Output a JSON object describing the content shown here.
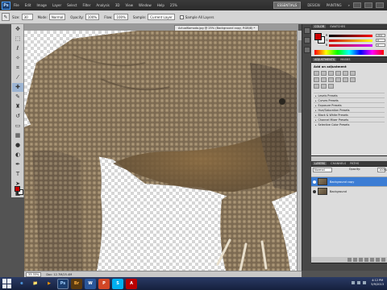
{
  "menubar": {
    "logo": "Ps",
    "items": [
      "File",
      "Edit",
      "Image",
      "Layer",
      "Select",
      "Filter",
      "Analysis",
      "3D",
      "View",
      "Window",
      "Help"
    ],
    "zoom": "25%",
    "workspaces": [
      "ESSENTIALS",
      "DESIGN",
      "PAINTING"
    ],
    "workspace_more": "»"
  },
  "options": {
    "size_label": "Size:",
    "size": "30",
    "mode_label": "Mode:",
    "mode": "Normal",
    "opacity_label": "Opacity:",
    "opacity": "100%",
    "flow_label": "Flow:",
    "flow": "100%",
    "sample_label": "Sample:",
    "sample": "Current Layer",
    "sample_all": "Sample All Layers"
  },
  "document": {
    "tab_title": "ActualKomodo.jpg @ 25% (Background copy, RGB/8) *",
    "zoom": "33.33%",
    "doc_info": "Doc: 12.7M/25.4M"
  },
  "colors": {
    "foreground": "#cc0000",
    "background": "#ffffff"
  },
  "panels": {
    "color": {
      "tab1": "COLOR",
      "tab2": "SWATCHES",
      "r": "R",
      "g": "G",
      "b": "B",
      "r_val": "204",
      "g_val": "0",
      "b_val": "0"
    },
    "adjustments": {
      "tab1": "ADJUSTMENTS",
      "tab2": "MASKS",
      "title": "Add an adjustment",
      "presets": [
        "Levels Presets",
        "Curves Presets",
        "Exposure Presets",
        "Hue/Saturation Presets",
        "Black & White Presets",
        "Channel Mixer Presets",
        "Selective Color Presets"
      ]
    },
    "layers": {
      "tab1": "LAYERS",
      "tab2": "CHANNELS",
      "tab3": "PATHS",
      "blend": "Normal",
      "opacity_label": "Opacity:",
      "opacity": "100%",
      "items": [
        "Background copy",
        "Background"
      ]
    }
  },
  "taskbar": {
    "apps": [
      "e",
      "📁",
      "▶",
      "Ps",
      "Br",
      "W",
      "P",
      "S",
      "A"
    ],
    "time": "4:12 PM",
    "date": "5/9/2013"
  }
}
